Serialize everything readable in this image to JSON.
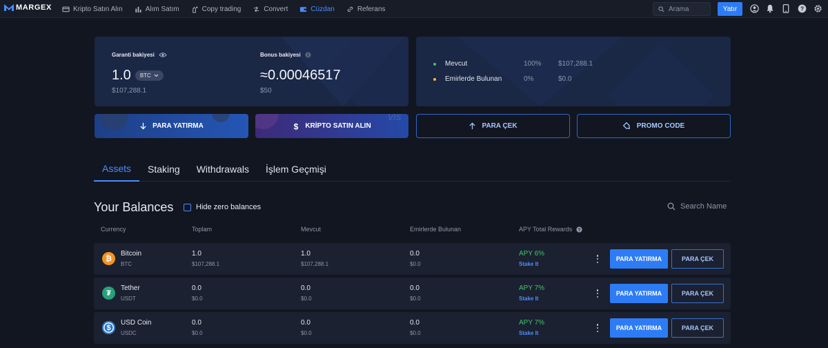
{
  "brand": {
    "name": "MARGEX"
  },
  "nav": {
    "items": [
      {
        "label": "Kripto Satın Alın",
        "icon": "card-icon"
      },
      {
        "label": "Alım Satım",
        "icon": "bar-chart-icon"
      },
      {
        "label": "Copy trading",
        "icon": "copy-trading-icon"
      },
      {
        "label": "Convert",
        "icon": "convert-icon"
      },
      {
        "label": "Cüzdan",
        "icon": "wallet-icon",
        "active": true
      },
      {
        "label": "Referans",
        "icon": "link-icon"
      }
    ],
    "search_placeholder": "Arama",
    "deposit_label": "Yatır"
  },
  "balance": {
    "guarantee_label": "Garanti bakiyesi",
    "guarantee_value": "1.0",
    "currency": "BTC",
    "guarantee_usd": "$107,288.1",
    "bonus_label": "Bonus bakiyesi",
    "bonus_value": "≈0.00046517",
    "bonus_usd": "$50"
  },
  "stats": [
    {
      "label": "Mevcut",
      "percent": "100%",
      "amount": "$107,288.1",
      "color": "#3fc56a"
    },
    {
      "label": "Emirlerde Bulunan",
      "percent": "0%",
      "amount": "$0.0",
      "color": "#f2c230"
    }
  ],
  "actions": {
    "deposit": "PARA YATIRMA",
    "buy_crypto": "KRİPTO SATIN ALIN",
    "withdraw": "PARA ÇEK",
    "promo": "PROMO CODE"
  },
  "tabs": [
    {
      "label": "Assets",
      "active": true
    },
    {
      "label": "Staking"
    },
    {
      "label": "Withdrawals"
    },
    {
      "label": "İşlem Geçmişi"
    }
  ],
  "balances": {
    "title": "Your Balances",
    "hide_zero_label": "Hide zero balances",
    "search_placeholder": "Search Name",
    "columns": [
      "Currency",
      "Toplam",
      "Mevcut",
      "Emirlerde Bulunan",
      "APY Total Rewards"
    ],
    "rows": [
      {
        "name": "Bitcoin",
        "symbol": "BTC",
        "total": "1.0",
        "total_usd": "$107,288.1",
        "available": "1.0",
        "available_usd": "$107,288.1",
        "in_orders": "0.0",
        "in_orders_usd": "$0.0",
        "apy": "APY 6%",
        "stake": "Stake It",
        "icon_color": "#f7931a",
        "glyph": "₿"
      },
      {
        "name": "Tether",
        "symbol": "USDT",
        "total": "0.0",
        "total_usd": "$0.0",
        "available": "0.0",
        "available_usd": "$0.0",
        "in_orders": "0.0",
        "in_orders_usd": "$0.0",
        "apy": "APY 7%",
        "stake": "Stake It",
        "icon_color": "#26a17b",
        "glyph": "₮"
      },
      {
        "name": "USD Coin",
        "symbol": "USDC",
        "total": "0.0",
        "total_usd": "$0.0",
        "available": "0.0",
        "available_usd": "$0.0",
        "in_orders": "0.0",
        "in_orders_usd": "$0.0",
        "apy": "APY 7%",
        "stake": "Stake It",
        "icon_color": "#2775ca",
        "glyph": "$"
      }
    ],
    "row_deposit": "PARA YATIRMA",
    "row_withdraw": "PARA ÇEK"
  }
}
